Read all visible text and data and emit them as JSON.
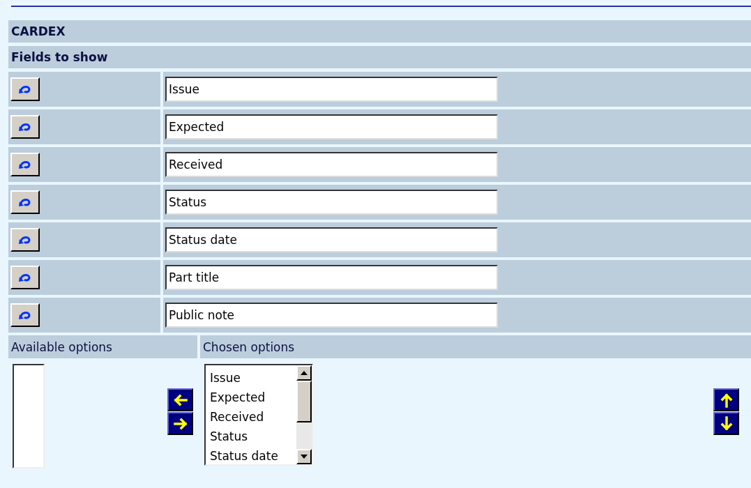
{
  "title": "CARDEX",
  "section": "Fields to show",
  "fields": [
    {
      "value": "Issue"
    },
    {
      "value": "Expected"
    },
    {
      "value": "Received"
    },
    {
      "value": "Status"
    },
    {
      "value": "Status date"
    },
    {
      "value": "Part title"
    },
    {
      "value": "Public note"
    }
  ],
  "available": {
    "label": "Available options"
  },
  "chosen": {
    "label": "Chosen options",
    "options": [
      "Issue",
      "Expected",
      "Received",
      "Status",
      "Status date"
    ]
  }
}
